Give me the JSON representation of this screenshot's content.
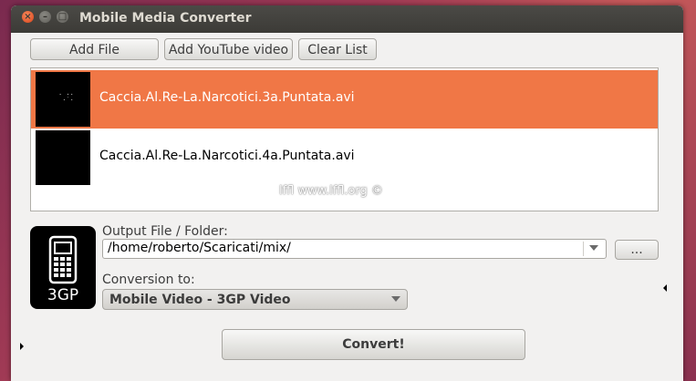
{
  "window": {
    "title": "Mobile Media Converter"
  },
  "window_buttons": {
    "close": "×",
    "minimize": "–",
    "maximize": "□"
  },
  "toolbar": {
    "add_file": "Add File",
    "add_youtube": "Add YouTube video",
    "clear_list": "Clear List"
  },
  "files": [
    {
      "name": "Caccia.Al.Re-La.Narcotici.3a.Puntata.avi",
      "selected": true
    },
    {
      "name": "Caccia.Al.Re-La.Narcotici.4a.Puntata.avi",
      "selected": false
    }
  ],
  "watermark": "lffl www.lffl.org ©",
  "format_icon": {
    "icon": "mobile-phone-icon",
    "label": "3GP"
  },
  "output": {
    "label": "Output File / Folder:",
    "value": "/home/roberto/Scaricati/mix/",
    "browse_label": "..."
  },
  "conversion": {
    "label": "Conversion to:",
    "selected": "Mobile Video - 3GP Video"
  },
  "convert_button": "Convert!",
  "colors": {
    "selection": "#f07746",
    "titlebar": "#3c3b37",
    "window_bg": "#f2f1f0"
  }
}
